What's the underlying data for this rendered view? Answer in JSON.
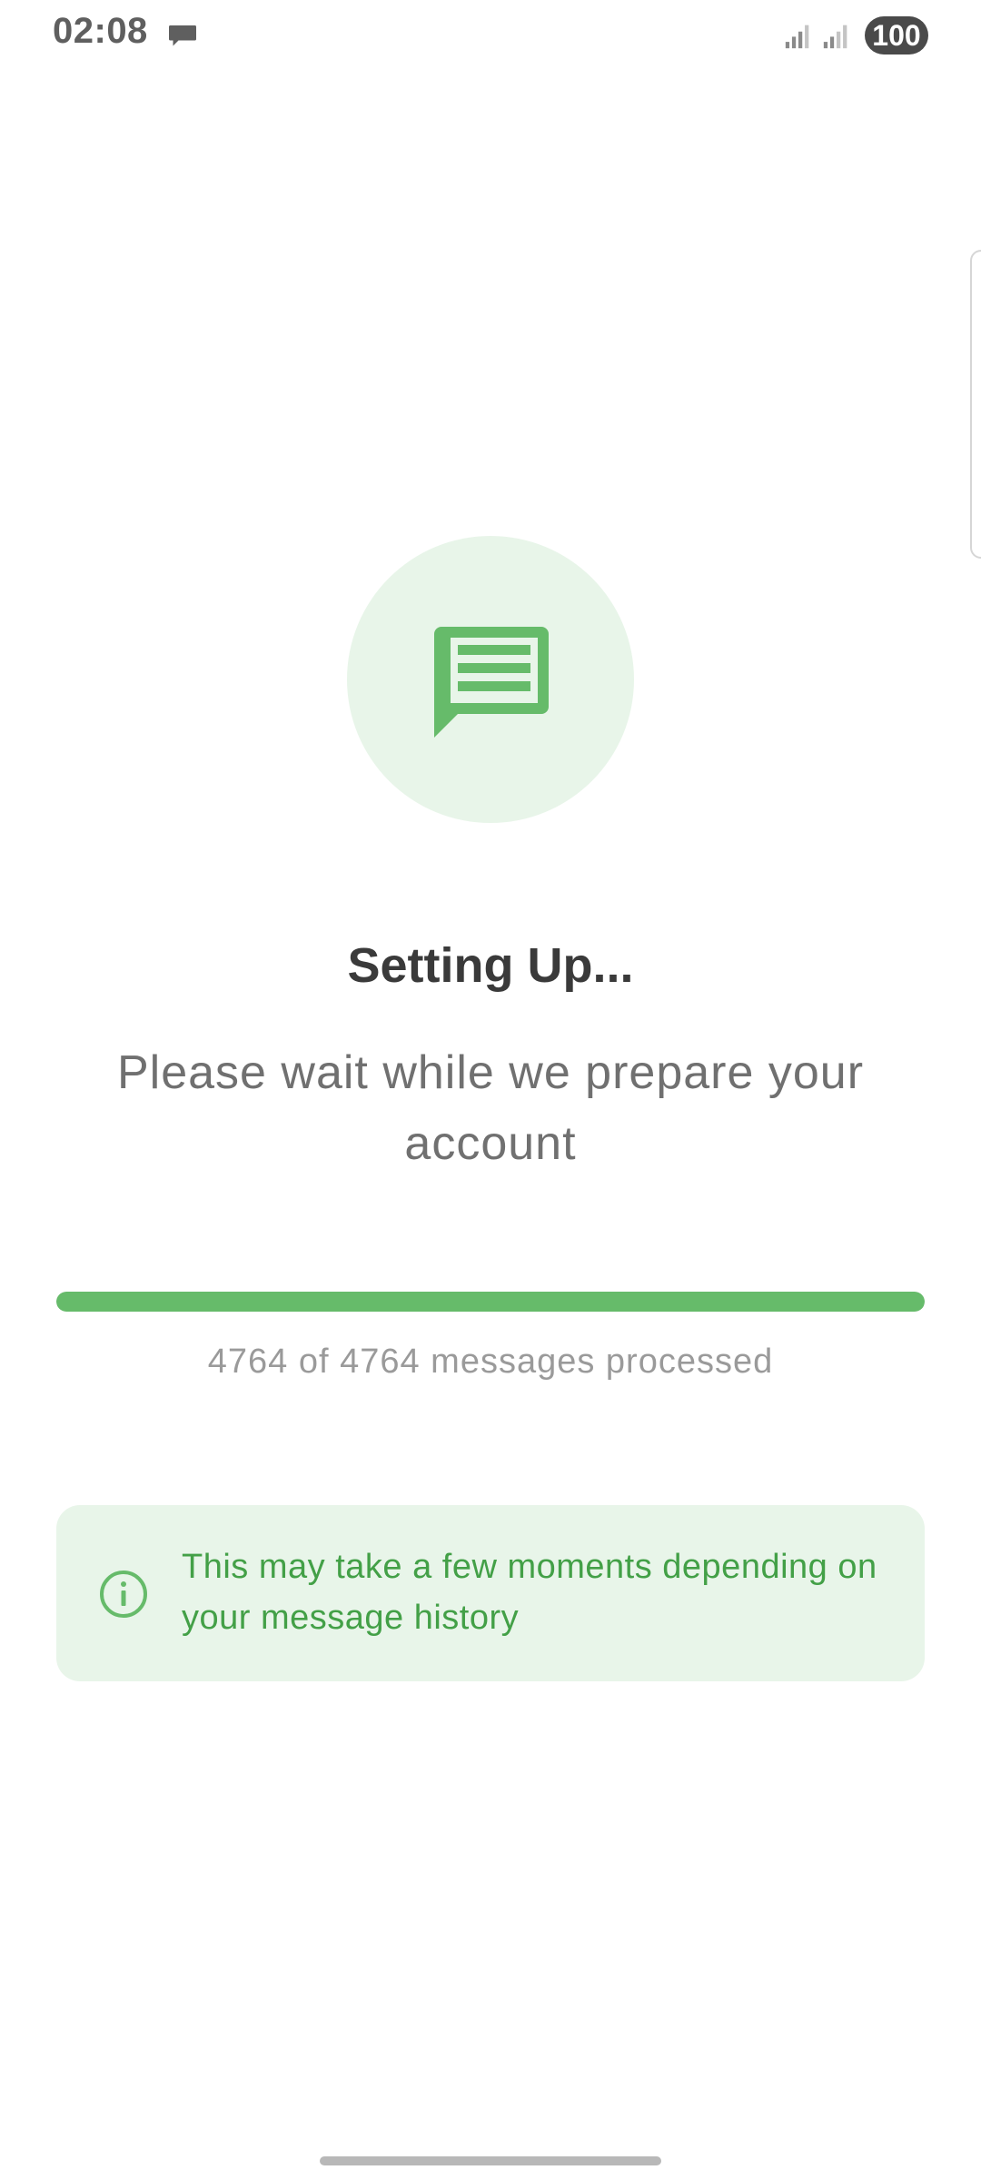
{
  "status_bar": {
    "time": "02:08",
    "notification_icon": "message-bubble-icon",
    "signal_icons": [
      "signal-icon",
      "signal-icon"
    ],
    "battery": "100"
  },
  "hero": {
    "icon": "message-icon",
    "icon_color": "#66bb6a",
    "circle_color": "#e8f5e9"
  },
  "title": "Setting Up...",
  "subtitle": "Please wait while we prepare your account",
  "progress": {
    "percent": 100,
    "text": "4764 of 4764 messages processed",
    "fill_color": "#66bb6a"
  },
  "info_card": {
    "icon": "info-icon",
    "text": "This may take a few moments depending on your message history",
    "text_color": "#43a047",
    "background": "#e8f5e9"
  }
}
